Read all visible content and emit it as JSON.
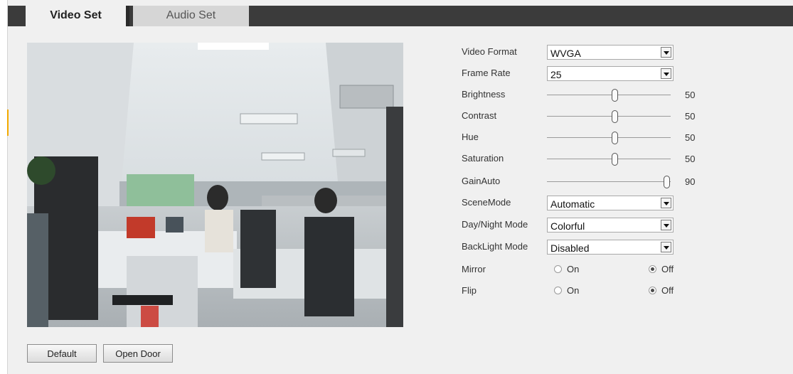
{
  "tabs": {
    "video": "Video Set",
    "audio": "Audio Set"
  },
  "settings": {
    "video_format": {
      "label": "Video Format",
      "value": "WVGA"
    },
    "frame_rate": {
      "label": "Frame Rate",
      "value": "25"
    },
    "brightness": {
      "label": "Brightness",
      "value": "50"
    },
    "contrast": {
      "label": "Contrast",
      "value": "50"
    },
    "hue": {
      "label": "Hue",
      "value": "50"
    },
    "saturation": {
      "label": "Saturation",
      "value": "50"
    },
    "gain_auto": {
      "label": "GainAuto",
      "value": "90"
    },
    "scene_mode": {
      "label": "SceneMode",
      "value": "Automatic"
    },
    "day_night_mode": {
      "label": "Day/Night Mode",
      "value": "Colorful"
    },
    "backlight_mode": {
      "label": "BackLight Mode",
      "value": "Disabled"
    },
    "mirror": {
      "label": "Mirror",
      "on": "On",
      "off": "Off",
      "selected": "Off"
    },
    "flip": {
      "label": "Flip",
      "on": "On",
      "off": "Off",
      "selected": "Off"
    }
  },
  "buttons": {
    "default": "Default",
    "open_door": "Open Door"
  },
  "icons": {
    "dropdown": "chevron-down-icon"
  },
  "colors": {
    "tab_bar": "#3b3b3b",
    "panel_bg": "#f0f0f0",
    "accent": "#f2a900"
  }
}
